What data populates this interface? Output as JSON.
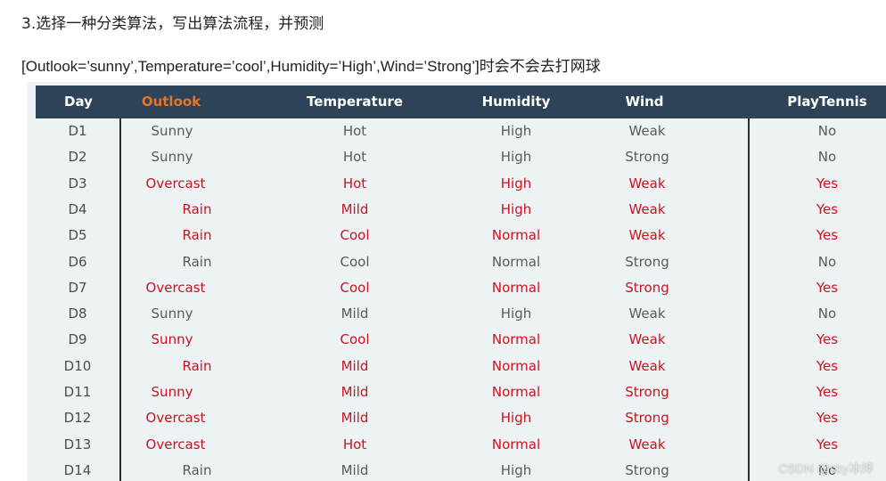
{
  "heading": "3.选择一种分类算法，写出算法流程，并预测",
  "query": "[Outlook=’sunny’,Temperature=’cool’,Humidity=’High’,Wind=’Strong’]时会不会去打网球",
  "colors": {
    "header_bg": "#2e4358",
    "header_text": "#ffffff",
    "outlook_header": "#e0752d",
    "positive_row_text": "#c8141e",
    "negative_row_text": "#5a5a5a",
    "table_bg": "#edf3f5"
  },
  "table": {
    "headers": [
      "Day",
      "Outlook",
      "Temperature",
      "Humidity",
      "Wind",
      "PlayTennis"
    ],
    "rows": [
      [
        "D1",
        "Sunny",
        "Hot",
        "High",
        "Weak",
        "No"
      ],
      [
        "D2",
        "Sunny",
        "Hot",
        "High",
        "Strong",
        "No"
      ],
      [
        "D3",
        "Overcast",
        "Hot",
        "High",
        "Weak",
        "Yes"
      ],
      [
        "D4",
        "Rain",
        "Mild",
        "High",
        "Weak",
        "Yes"
      ],
      [
        "D5",
        "Rain",
        "Cool",
        "Normal",
        "Weak",
        "Yes"
      ],
      [
        "D6",
        "Rain",
        "Cool",
        "Normal",
        "Strong",
        "No"
      ],
      [
        "D7",
        "Overcast",
        "Cool",
        "Normal",
        "Strong",
        "Yes"
      ],
      [
        "D8",
        "Sunny",
        "Mild",
        "High",
        "Weak",
        "No"
      ],
      [
        "D9",
        "Sunny",
        "Cool",
        "Normal",
        "Weak",
        "Yes"
      ],
      [
        "D10",
        "Rain",
        "Mild",
        "Normal",
        "Weak",
        "Yes"
      ],
      [
        "D11",
        "Sunny",
        "Mild",
        "Normal",
        "Strong",
        "Yes"
      ],
      [
        "D12",
        "Overcast",
        "Mild",
        "High",
        "Strong",
        "Yes"
      ],
      [
        "D13",
        "Overcast",
        "Hot",
        "Normal",
        "Weak",
        "Yes"
      ],
      [
        "D14",
        "Rain",
        "Mild",
        "High",
        "Strong",
        "No"
      ]
    ]
  },
  "watermark": "CSDN @sky冰烨"
}
